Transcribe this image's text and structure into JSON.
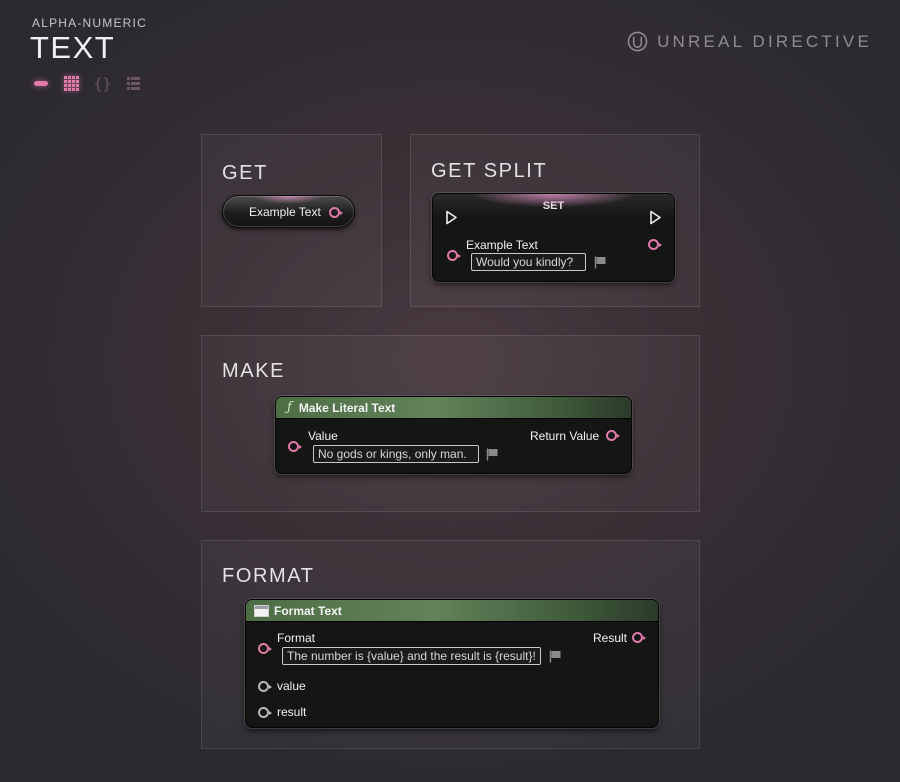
{
  "header": {
    "category": "ALPHA-NUMERIC",
    "title": "TEXT",
    "type_icons": [
      "single-variable-icon",
      "map-grid-icon",
      "struct-brace-icon",
      "list-array-icon"
    ]
  },
  "brand": {
    "name": "UNREAL DIRECTIVE",
    "logo": "unreal-logo-icon"
  },
  "colors": {
    "pin_text": "#e07aa8",
    "node_header_function": "#5c7f53",
    "background": "#2c2a30"
  },
  "panels": {
    "get": {
      "title": "GET",
      "variable_node": {
        "label": "Example Text"
      }
    },
    "get_split": {
      "title": "GET SPLIT",
      "set_node": {
        "header": "SET",
        "pin_label": "Example Text",
        "value": "Would you kindly?"
      }
    },
    "make": {
      "title": "MAKE",
      "node": {
        "header": "Make Literal Text",
        "input_label": "Value",
        "output_label": "Return Value",
        "value": "No gods or kings, only man."
      }
    },
    "format": {
      "title": "FORMAT",
      "node": {
        "header": "Format Text",
        "input_label": "Format",
        "output_label": "Result",
        "value": "The number is {value} and the result is {result}!",
        "args": [
          "value",
          "result"
        ]
      }
    }
  }
}
